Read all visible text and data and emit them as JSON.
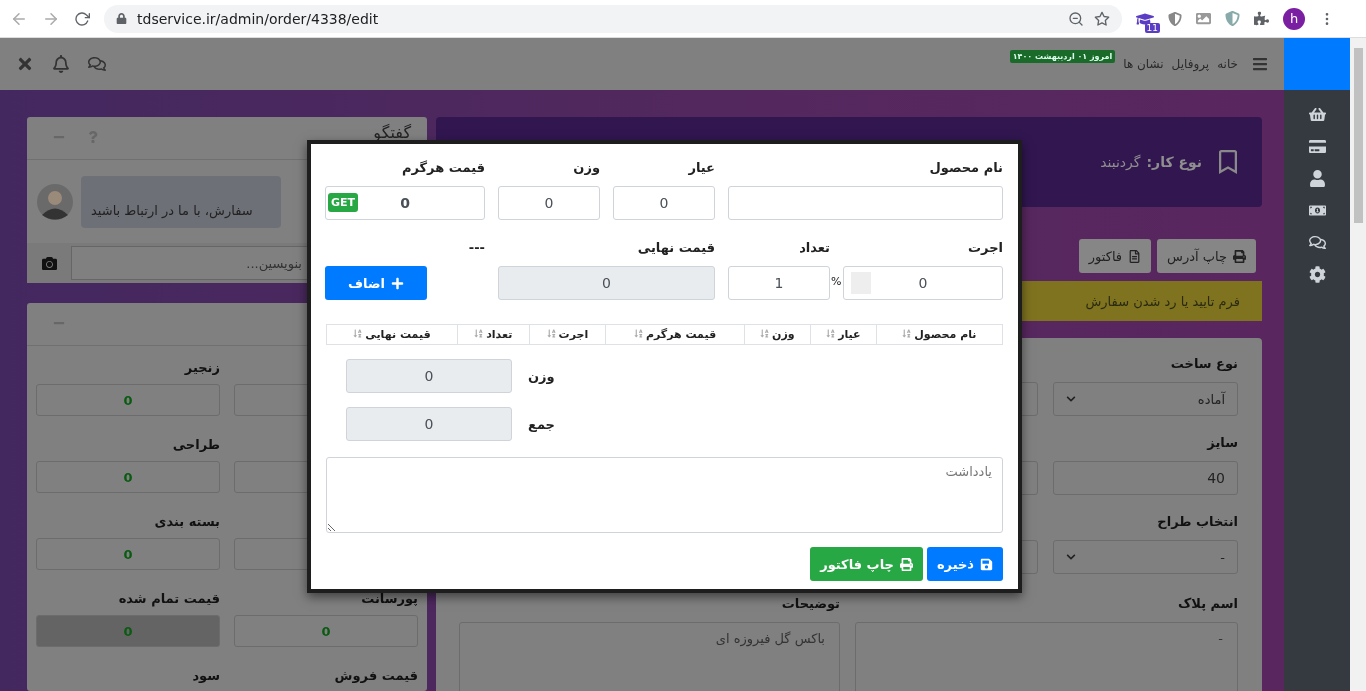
{
  "browser": {
    "url": "tdservice.ir/admin/order/4338/edit",
    "extension_badge": "11",
    "profile_initial": "h"
  },
  "topbar": {
    "nav": [
      {
        "label": "خانه"
      },
      {
        "label": "پروفایل"
      },
      {
        "label": "نشان ها"
      }
    ],
    "date_badge": "امروز ۰۱ اردیبهشت ۱۴۰۰"
  },
  "chat": {
    "title": "گفتگو",
    "message": "سفارش، با ما در ارتباط باشید",
    "input_placeholder": "بنویسین..."
  },
  "summary": {
    "fields": [
      {
        "disabled": false
      },
      {
        "label": "زنجیر",
        "value": "0",
        "disabled": false
      },
      {
        "disabled": false
      },
      {
        "label": "طراحی",
        "value": "0",
        "disabled": false
      },
      {
        "disabled": false
      },
      {
        "label": "بسته بندی",
        "value": "0",
        "disabled": false
      },
      {
        "label": "پورسانت",
        "value": "0",
        "disabled": false
      },
      {
        "label": "قیمت تمام شده",
        "value": "0",
        "disabled": true
      },
      {
        "label": "قیمت فروش"
      },
      {
        "label": "سود"
      }
    ]
  },
  "order": {
    "job_label": "نوع کار:",
    "job_value": "گردنبند",
    "buttons": [
      {
        "kind": "print",
        "label": "چاپ آدرس"
      },
      {
        "kind": "file",
        "label": "فاکتور"
      }
    ],
    "alert": "فرم تایید یا رد شدن سفارش",
    "fields": [
      {
        "kind": "select",
        "label": "نوع ساخت",
        "value": "آماده"
      },
      {
        "kind": "input",
        "label": "سایز",
        "value": "40"
      },
      {
        "kind": "select",
        "label": "انتخاب طراح",
        "value": "-"
      }
    ],
    "textareas": [
      {
        "label": "اسم پلاک",
        "value": "-"
      },
      {
        "label": "توضیحات",
        "value": "باکس گل فیروزه ای"
      }
    ]
  },
  "modal": {
    "fields": [
      {
        "kind": "text",
        "label": "نام محصول"
      },
      {
        "kind": "number",
        "label": "عیار",
        "value": "0"
      },
      {
        "kind": "number",
        "label": "وزن",
        "value": "0"
      },
      {
        "kind": "price",
        "label": "قیمت هرگرم",
        "value": "0",
        "button": "GET"
      },
      {
        "kind": "percent",
        "label": "اجرت",
        "value": "0",
        "unit": "%"
      },
      {
        "kind": "number",
        "label": "تعداد",
        "value": "1"
      },
      {
        "kind": "readonly",
        "label": "قیمت نهایی",
        "value": "0"
      },
      {
        "kind": "action",
        "label": "---",
        "button": "اضاف"
      }
    ],
    "table_columns": [
      "نام محصول",
      "عیار",
      "وزن",
      "قیمت هرگرم",
      "اجرت",
      "تعداد",
      "قیمت نهایی"
    ],
    "totals": [
      {
        "label": "وزن",
        "value": "0"
      },
      {
        "label": "جمع",
        "value": "0"
      }
    ],
    "note_placeholder": "یادداشت",
    "buttons": [
      {
        "kind": "save",
        "label": "ذخیره"
      },
      {
        "kind": "print",
        "label": "چاپ فاکتور"
      }
    ]
  }
}
